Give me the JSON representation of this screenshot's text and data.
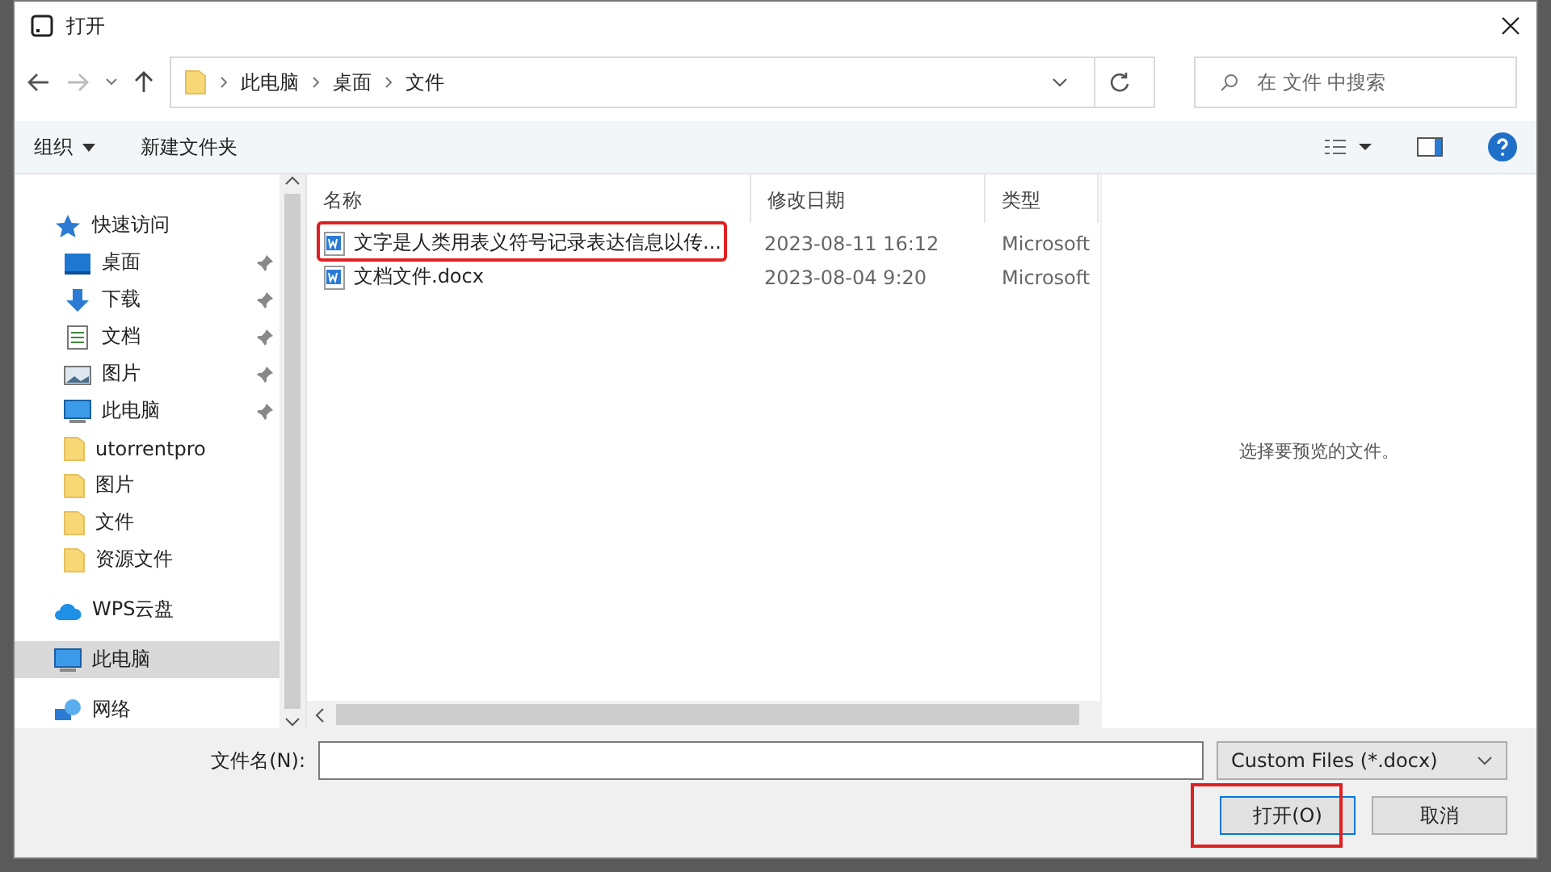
{
  "window": {
    "title": "打开"
  },
  "breadcrumb": [
    "此电脑",
    "桌面",
    "文件"
  ],
  "search": {
    "placeholder": "在 文件 中搜索"
  },
  "toolbar": {
    "organize": "组织",
    "new_folder": "新建文件夹"
  },
  "sidebar": {
    "items": [
      {
        "label": "快速访问",
        "kind": "star",
        "selected": false,
        "children": [
          {
            "label": "桌面",
            "kind": "desktop",
            "pinned": true,
            "selected": false
          },
          {
            "label": "下载",
            "kind": "download",
            "pinned": true,
            "selected": false
          },
          {
            "label": "文档",
            "kind": "document",
            "pinned": true,
            "selected": false
          },
          {
            "label": "图片",
            "kind": "image",
            "pinned": true,
            "selected": false
          },
          {
            "label": "此电脑",
            "kind": "computer",
            "pinned": true,
            "selected": false
          },
          {
            "label": "utorrentpro",
            "kind": "folder",
            "pinned": false,
            "selected": false
          },
          {
            "label": "图片",
            "kind": "folder",
            "pinned": false,
            "selected": false
          },
          {
            "label": "文件",
            "kind": "folder",
            "pinned": false,
            "selected": false
          },
          {
            "label": "资源文件",
            "kind": "folder",
            "pinned": false,
            "selected": false
          }
        ]
      },
      {
        "label": "WPS云盘",
        "kind": "cloud",
        "selected": false
      },
      {
        "label": "此电脑",
        "kind": "computer",
        "selected": true
      },
      {
        "label": "网络",
        "kind": "network",
        "selected": false
      }
    ]
  },
  "table": {
    "columns": [
      "名称",
      "修改日期",
      "类型"
    ],
    "rows": [
      {
        "name": "文字是人类用表义符号记录表达信息以传...",
        "modified": "2023-08-11 16:12",
        "type": "Microsoft",
        "highlighted": true
      },
      {
        "name": "文档文件.docx",
        "modified": "2023-08-04 9:20",
        "type": "Microsoft",
        "highlighted": false
      }
    ]
  },
  "preview": {
    "message": "选择要预览的文件。"
  },
  "footer": {
    "filename_label": "文件名(N):",
    "filetype": "Custom Files (*.docx)",
    "open": "打开(O)",
    "open_highlighted": true,
    "cancel": "取消"
  }
}
